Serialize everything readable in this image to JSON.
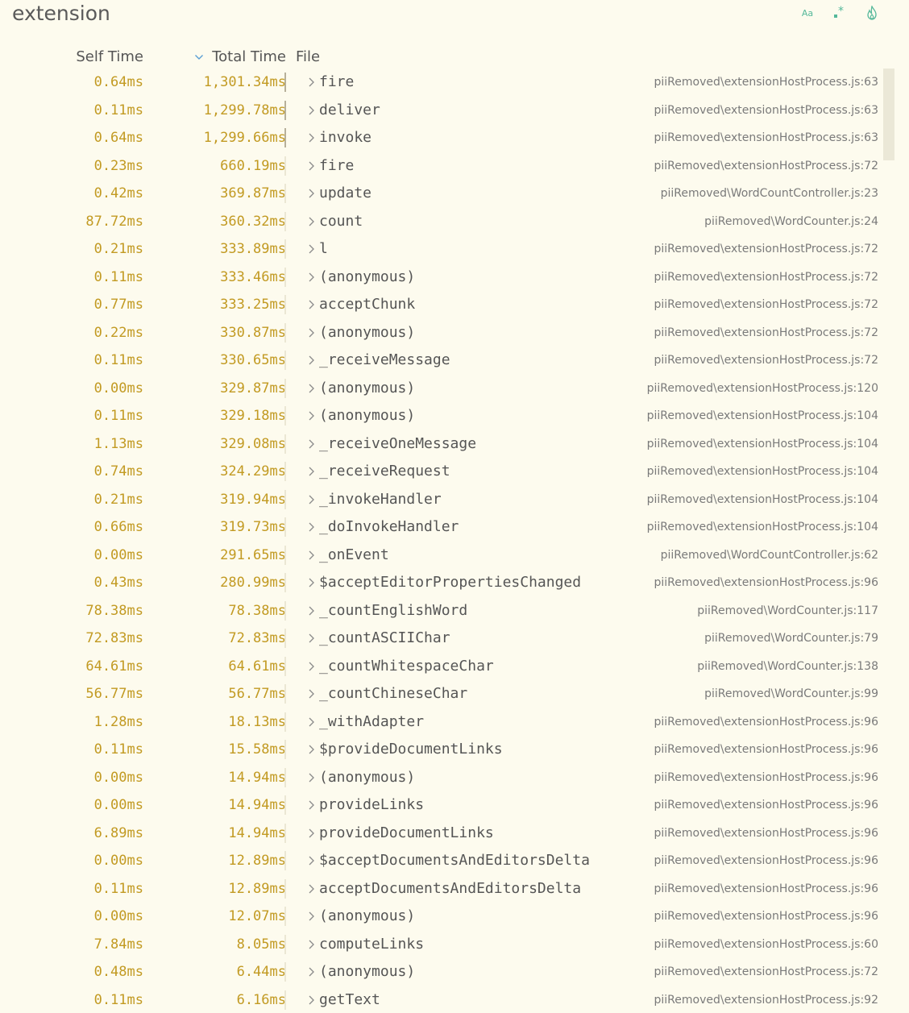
{
  "view": {
    "title": "extension",
    "toolbar": [
      {
        "name": "match-case",
        "label": "Aa"
      },
      {
        "name": "regex",
        "icon": "regex-icon"
      },
      {
        "name": "flame",
        "icon": "flame-icon"
      }
    ]
  },
  "columns": {
    "self": "Self Time",
    "total": "Total Time",
    "file": "File",
    "sort_icon": "chevron-down-icon"
  },
  "colors": {
    "background": "#fdfbee",
    "time": "#c29a22",
    "accent": "#55b89a"
  },
  "rows": [
    {
      "self": "0.64ms",
      "total": "1,301.34ms",
      "fn": "fire",
      "file": "piiRemoved\\extensionHostProcess.js:63"
    },
    {
      "self": "0.11ms",
      "total": "1,299.78ms",
      "fn": "deliver",
      "file": "piiRemoved\\extensionHostProcess.js:63"
    },
    {
      "self": "0.64ms",
      "total": "1,299.66ms",
      "fn": "invoke",
      "file": "piiRemoved\\extensionHostProcess.js:63"
    },
    {
      "self": "0.23ms",
      "total": "660.19ms",
      "fn": "fire",
      "file": "piiRemoved\\extensionHostProcess.js:72"
    },
    {
      "self": "0.42ms",
      "total": "369.87ms",
      "fn": "update",
      "file": "piiRemoved\\WordCountController.js:23"
    },
    {
      "self": "87.72ms",
      "total": "360.32ms",
      "fn": "count",
      "file": "piiRemoved\\WordCounter.js:24"
    },
    {
      "self": "0.21ms",
      "total": "333.89ms",
      "fn": "l",
      "file": "piiRemoved\\extensionHostProcess.js:72"
    },
    {
      "self": "0.11ms",
      "total": "333.46ms",
      "fn": "(anonymous)",
      "file": "piiRemoved\\extensionHostProcess.js:72"
    },
    {
      "self": "0.77ms",
      "total": "333.25ms",
      "fn": "acceptChunk",
      "file": "piiRemoved\\extensionHostProcess.js:72"
    },
    {
      "self": "0.22ms",
      "total": "330.87ms",
      "fn": "(anonymous)",
      "file": "piiRemoved\\extensionHostProcess.js:72"
    },
    {
      "self": "0.11ms",
      "total": "330.65ms",
      "fn": "_receiveMessage",
      "file": "piiRemoved\\extensionHostProcess.js:72"
    },
    {
      "self": "0.00ms",
      "total": "329.87ms",
      "fn": "(anonymous)",
      "file": "piiRemoved\\extensionHostProcess.js:120"
    },
    {
      "self": "0.11ms",
      "total": "329.18ms",
      "fn": "(anonymous)",
      "file": "piiRemoved\\extensionHostProcess.js:104"
    },
    {
      "self": "1.13ms",
      "total": "329.08ms",
      "fn": "_receiveOneMessage",
      "file": "piiRemoved\\extensionHostProcess.js:104"
    },
    {
      "self": "0.74ms",
      "total": "324.29ms",
      "fn": "_receiveRequest",
      "file": "piiRemoved\\extensionHostProcess.js:104"
    },
    {
      "self": "0.21ms",
      "total": "319.94ms",
      "fn": "_invokeHandler",
      "file": "piiRemoved\\extensionHostProcess.js:104"
    },
    {
      "self": "0.66ms",
      "total": "319.73ms",
      "fn": "_doInvokeHandler",
      "file": "piiRemoved\\extensionHostProcess.js:104"
    },
    {
      "self": "0.00ms",
      "total": "291.65ms",
      "fn": "_onEvent",
      "file": "piiRemoved\\WordCountController.js:62"
    },
    {
      "self": "0.43ms",
      "total": "280.99ms",
      "fn": "$acceptEditorPropertiesChanged",
      "file": "piiRemoved\\extensionHostProcess.js:96"
    },
    {
      "self": "78.38ms",
      "total": "78.38ms",
      "fn": "_countEnglishWord",
      "file": "piiRemoved\\WordCounter.js:117"
    },
    {
      "self": "72.83ms",
      "total": "72.83ms",
      "fn": "_countASCIIChar",
      "file": "piiRemoved\\WordCounter.js:79"
    },
    {
      "self": "64.61ms",
      "total": "64.61ms",
      "fn": "_countWhitespaceChar",
      "file": "piiRemoved\\WordCounter.js:138"
    },
    {
      "self": "56.77ms",
      "total": "56.77ms",
      "fn": "_countChineseChar",
      "file": "piiRemoved\\WordCounter.js:99"
    },
    {
      "self": "1.28ms",
      "total": "18.13ms",
      "fn": "_withAdapter",
      "file": "piiRemoved\\extensionHostProcess.js:96"
    },
    {
      "self": "0.11ms",
      "total": "15.58ms",
      "fn": "$provideDocumentLinks",
      "file": "piiRemoved\\extensionHostProcess.js:96"
    },
    {
      "self": "0.00ms",
      "total": "14.94ms",
      "fn": "(anonymous)",
      "file": "piiRemoved\\extensionHostProcess.js:96"
    },
    {
      "self": "0.00ms",
      "total": "14.94ms",
      "fn": "provideLinks",
      "file": "piiRemoved\\extensionHostProcess.js:96"
    },
    {
      "self": "6.89ms",
      "total": "14.94ms",
      "fn": "provideDocumentLinks",
      "file": "piiRemoved\\extensionHostProcess.js:96"
    },
    {
      "self": "0.00ms",
      "total": "12.89ms",
      "fn": "$acceptDocumentsAndEditorsDelta",
      "file": "piiRemoved\\extensionHostProcess.js:96"
    },
    {
      "self": "0.11ms",
      "total": "12.89ms",
      "fn": "acceptDocumentsAndEditorsDelta",
      "file": "piiRemoved\\extensionHostProcess.js:96"
    },
    {
      "self": "0.00ms",
      "total": "12.07ms",
      "fn": "(anonymous)",
      "file": "piiRemoved\\extensionHostProcess.js:96"
    },
    {
      "self": "7.84ms",
      "total": "8.05ms",
      "fn": "computeLinks",
      "file": "piiRemoved\\extensionHostProcess.js:60"
    },
    {
      "self": "0.48ms",
      "total": "6.44ms",
      "fn": "(anonymous)",
      "file": "piiRemoved\\extensionHostProcess.js:72"
    },
    {
      "self": "0.11ms",
      "total": "6.16ms",
      "fn": "getText",
      "file": "piiRemoved\\extensionHostProcess.js:92"
    }
  ]
}
